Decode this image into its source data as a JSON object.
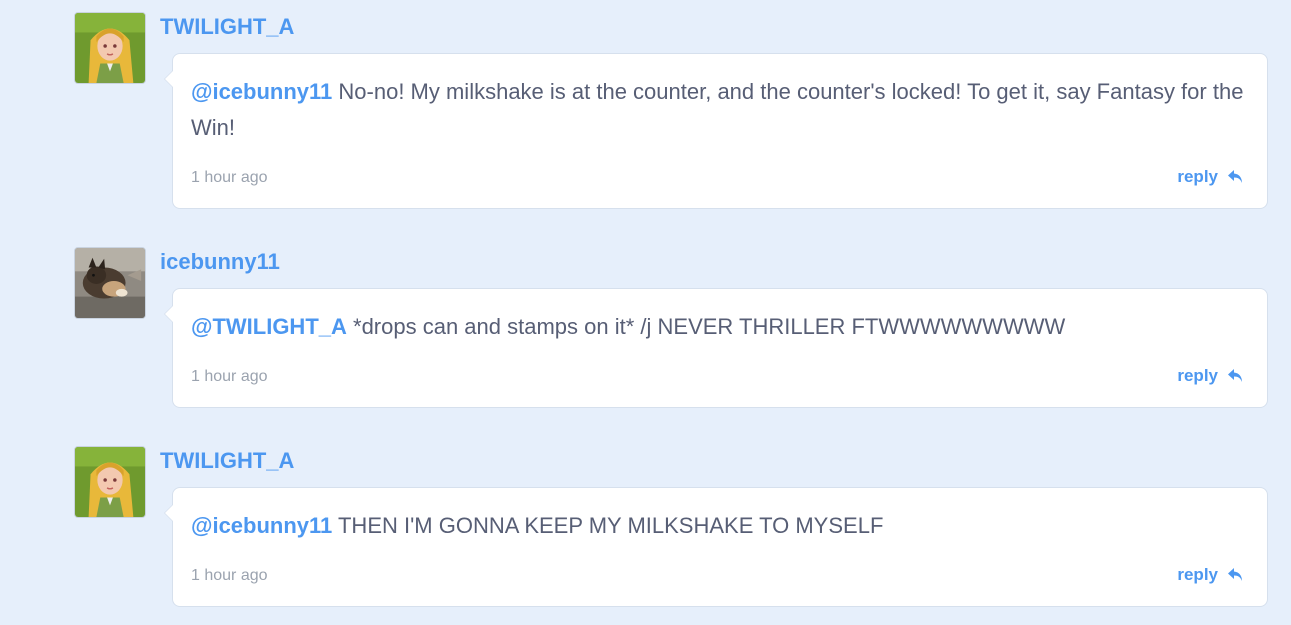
{
  "comments": [
    {
      "username": "TWILIGHT_A",
      "avatar": "anime-girl-avatar",
      "mention": "@icebunny11",
      "text": " No-no! My milkshake is at the counter, and the counter's locked! To get it, say Fantasy for the Win!",
      "time": "1 hour ago",
      "reply_label": "reply"
    },
    {
      "username": "icebunny11",
      "avatar": "dog-photo-avatar",
      "mention": "@TWILIGHT_A",
      "text": " *drops can and stamps on it* /j NEVER THRILLER FTWWWWWWWWW",
      "time": "1 hour ago",
      "reply_label": "reply"
    },
    {
      "username": "TWILIGHT_A",
      "avatar": "anime-girl-avatar",
      "mention": "@icebunny11",
      "text": " THEN I'M GONNA KEEP MY MILKSHAKE TO MYSELF",
      "time": "1 hour ago",
      "reply_label": "reply"
    }
  ],
  "colors": {
    "background": "#e6effb",
    "link": "#4c97f0",
    "text": "#575e75",
    "muted": "#9ba3af"
  }
}
